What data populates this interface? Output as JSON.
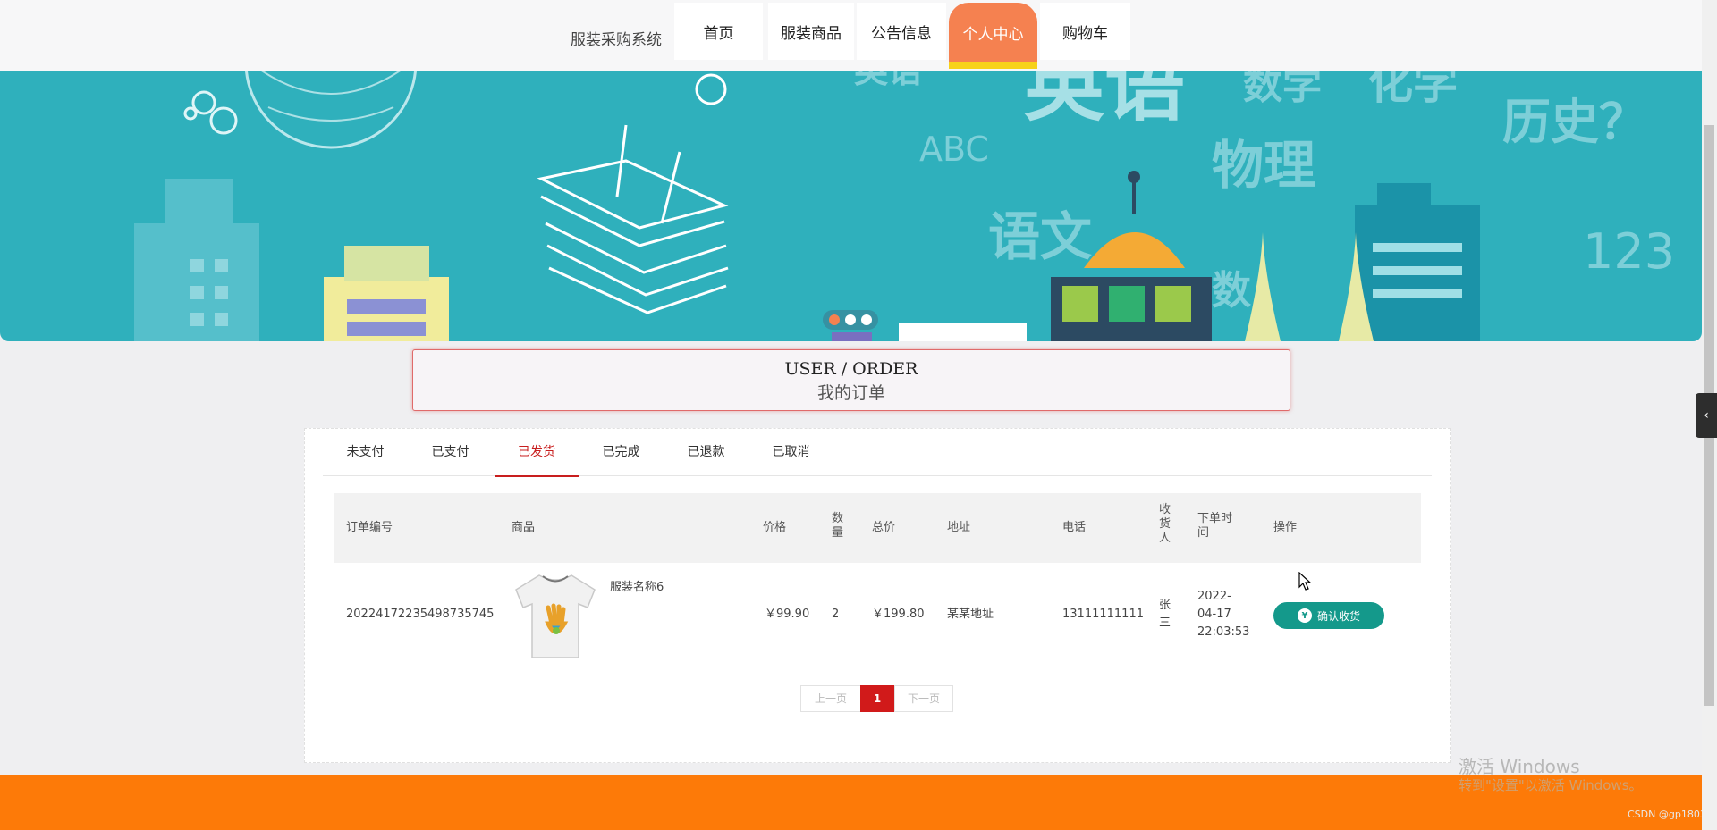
{
  "header": {
    "site_title": "服装采购系统",
    "nav": [
      {
        "label": "首页"
      },
      {
        "label": "服装商品"
      },
      {
        "label": "公告信息"
      },
      {
        "label": "个人中心",
        "active": true
      },
      {
        "label": "购物车"
      }
    ]
  },
  "banner": {
    "texts": [
      "英语",
      "数学",
      "化学",
      "历史？",
      "ABC",
      "物理",
      "语文",
      "数",
      "123"
    ],
    "slide_count": 3,
    "active_slide": 1
  },
  "section": {
    "title_en": "USER / ORDER",
    "title_cn": "我的订单"
  },
  "orders": {
    "tabs": [
      "未支付",
      "已支付",
      "已发货",
      "已完成",
      "已退款",
      "已取消"
    ],
    "active_tab": "已发货",
    "columns": {
      "order_no": "订单编号",
      "product": "商品",
      "price": "价格",
      "qty_a": "数",
      "qty_b": "量",
      "total": "总价",
      "address": "地址",
      "phone": "电话",
      "recv_a": "收",
      "recv_b": "货",
      "recv_c": "人",
      "time_a": "下单时",
      "time_b": "间",
      "action": "操作"
    },
    "rows": [
      {
        "order_no": "20224172235498735745",
        "product_name": "服装名称6",
        "price": "￥99.90",
        "qty": "2",
        "total": "￥199.80",
        "address": "某某地址",
        "phone": "13111111111",
        "receiver_a": "张",
        "receiver_b": "三",
        "time_a": "2022-",
        "time_b": "04-17",
        "time_c": "22:03:53",
        "action_label": "确认收货",
        "action_icon": "yen-icon",
        "action_color": "#14998b"
      }
    ],
    "pagination": {
      "prev": "上一页",
      "current": "1",
      "next": "下一页"
    }
  },
  "watermark": {
    "line1": "激活 Windows",
    "line2": "转到\"设置\"以激活 Windows。",
    "csdn": "CSDN @gp1803"
  },
  "colors": {
    "nav_active": "#f58150",
    "nav_active_underline": "#f7d21a",
    "banner": "#2fb0bc",
    "footer": "#fd7a08",
    "tab_active": "#c81e1e",
    "page_current": "#d11a1a"
  }
}
